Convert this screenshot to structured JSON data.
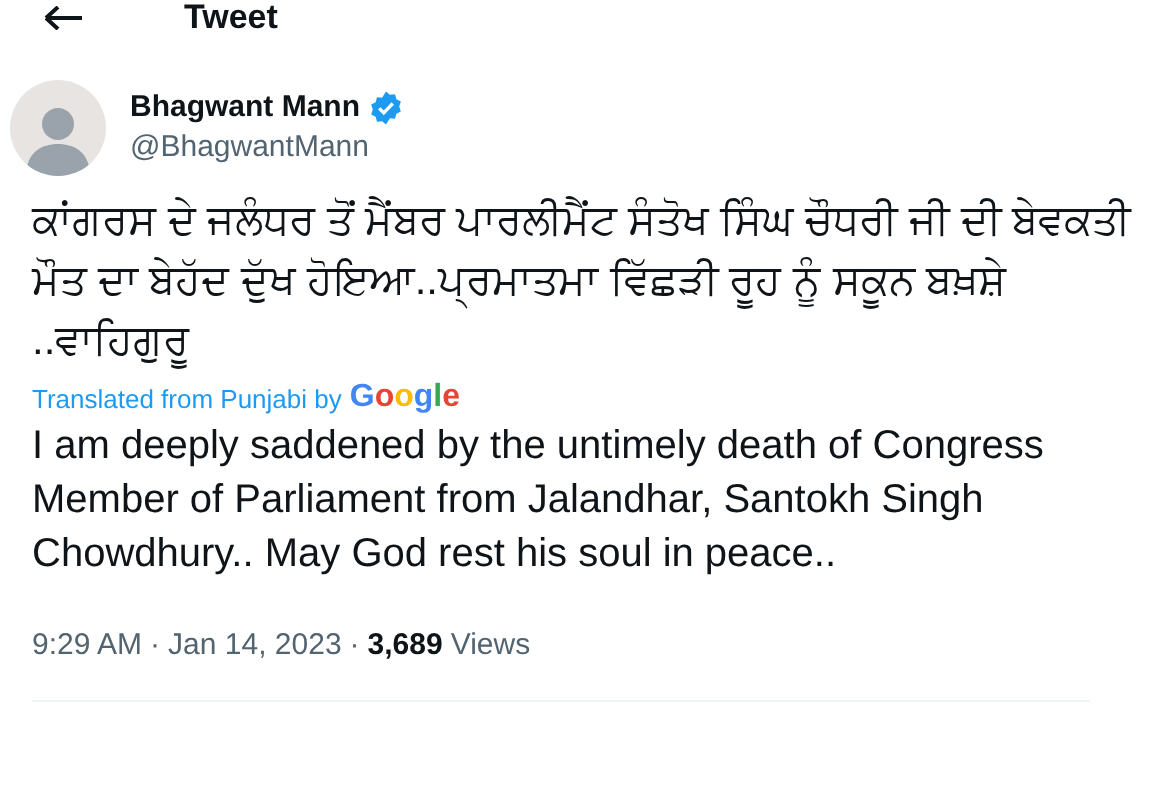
{
  "header": {
    "title": "Tweet"
  },
  "author": {
    "name": "Bhagwant Mann",
    "handle": "@BhagwantMann",
    "verified": true
  },
  "tweet": {
    "text": "ਕਾਂਗਰਸ ਦੇ ਜਲੰਧਰ ਤੋਂ ਮੈਂਬਰ ਪਾਰਲੀਮੈਂਟ ਸੰਤੋਖ ਸਿੰਘ ਚੌਧਰੀ ਜੀ ਦੀ ਬੇਵਕਤੀ ਮੌਤ ਦਾ ਬੇਹੱਦ ਦੁੱਖ ਹੋਇਆ..ਪ੍ਰਮਾਤਮਾ ਵਿੱਛੜੀ ਰੂਹ ਨੂੰ ਸਕੂਨ ਬਖ਼ਸ਼ੇ ..ਵਾਹਿਗੁਰੂ",
    "translation_label": "Translated from Punjabi by",
    "translation_provider": "Google",
    "translation": "I am deeply saddened by the untimely death of Congress Member of Parliament from Jalandhar, Santokh Singh Chowdhury.. May God rest his soul in peace.."
  },
  "meta": {
    "time": "9:29 AM",
    "separator_1": "·",
    "date": "Jan 14, 2023",
    "separator_2": "·",
    "views_count": "3,689",
    "views_label": "Views"
  }
}
